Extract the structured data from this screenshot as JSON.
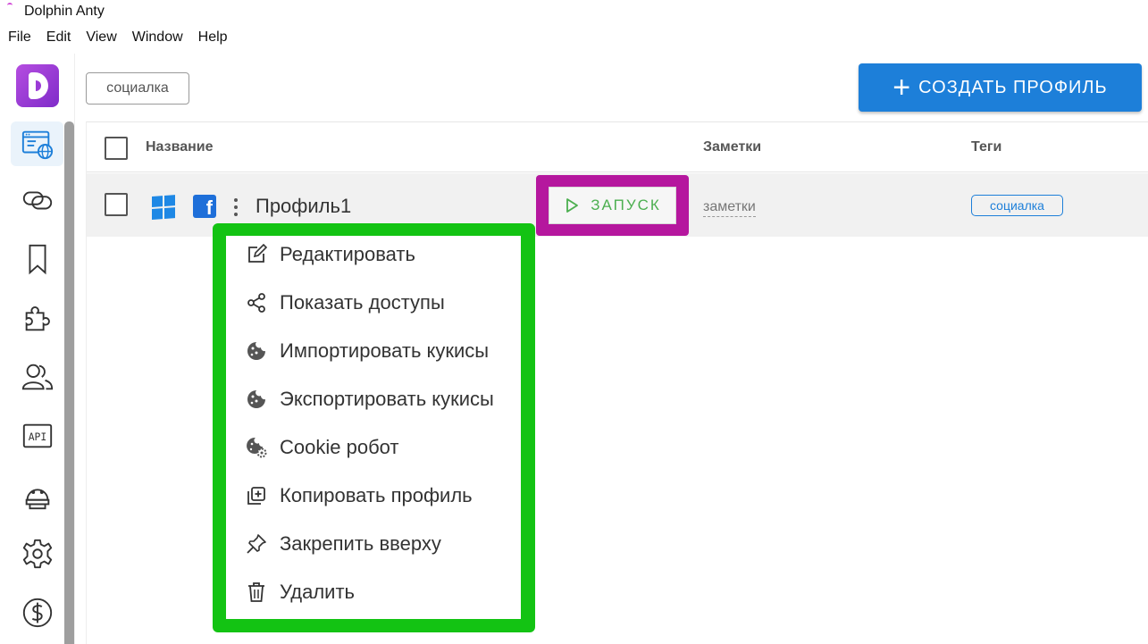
{
  "window": {
    "title": "Dolphin Anty"
  },
  "menubar": [
    "File",
    "Edit",
    "View",
    "Window",
    "Help"
  ],
  "filter": {
    "tag_chip": "социалка"
  },
  "toolbar": {
    "create_label": "СОЗДАТЬ ПРОФИЛЬ"
  },
  "table": {
    "headers": {
      "name": "Название",
      "notes": "Заметки",
      "tags": "Теги"
    },
    "rows": [
      {
        "name": "Профиль1",
        "launch_label": "ЗАПУСК",
        "notes": "заметки",
        "tag": "социалка"
      }
    ]
  },
  "context_menu": [
    {
      "label": "Редактировать",
      "icon": "edit-icon"
    },
    {
      "label": "Показать доступы",
      "icon": "share-icon"
    },
    {
      "label": "Импортировать кукисы",
      "icon": "cookie-icon"
    },
    {
      "label": "Экспортировать кукисы",
      "icon": "cookie-icon"
    },
    {
      "label": "Cookie робот",
      "icon": "cookie-gear-icon"
    },
    {
      "label": "Копировать профиль",
      "icon": "copy-icon"
    },
    {
      "label": "Закрепить вверху",
      "icon": "pin-icon"
    },
    {
      "label": "Удалить",
      "icon": "trash-icon"
    }
  ],
  "sidebar": {
    "items": [
      {
        "icon": "browser-globe-icon",
        "active": true
      },
      {
        "icon": "proxy-link-icon"
      },
      {
        "icon": "bookmark-icon"
      },
      {
        "icon": "puzzle-icon"
      },
      {
        "icon": "users-icon"
      },
      {
        "icon": "api-icon",
        "label": "API"
      },
      {
        "icon": "robot-icon"
      },
      {
        "icon": "gear-icon"
      },
      {
        "icon": "dollar-icon"
      }
    ]
  },
  "colors": {
    "accent": "#1d7fd9",
    "launch_green": "#4caf50",
    "highlight_magenta": "#b5179e",
    "highlight_green": "#13c313"
  }
}
